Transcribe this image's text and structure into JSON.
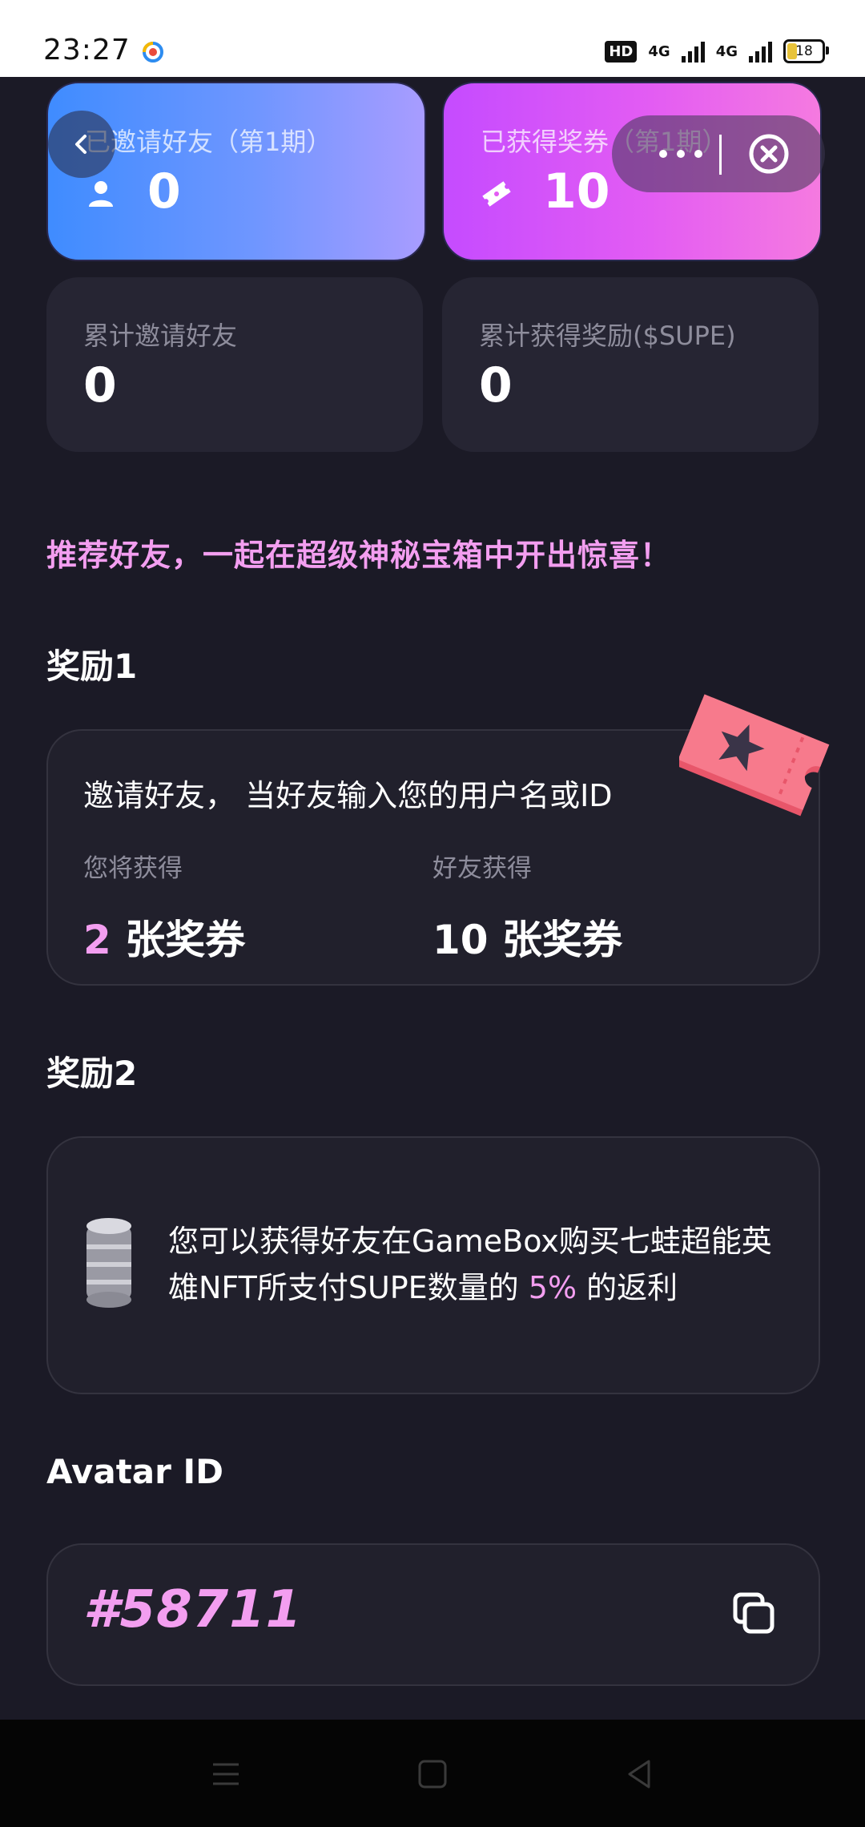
{
  "status_bar": {
    "time": "23:27",
    "hd_badge": "HD",
    "net_1": "4G",
    "net_2": "4G",
    "battery": "18"
  },
  "stats": {
    "invited_current": {
      "label": "已邀请好友（第1期）",
      "value": "0",
      "icon": "user-icon"
    },
    "tickets_current": {
      "label": "已获得奖券（第1期）",
      "value": "10",
      "icon": "ticket-icon"
    },
    "invited_total": {
      "label": "累计邀请好友",
      "value": "0"
    },
    "reward_total": {
      "label": "累计获得奖励($SUPE)",
      "value": "0"
    }
  },
  "headline": "推荐好友，一起在超级神秘宝箱中开出惊喜！",
  "reward1": {
    "title": "奖励1",
    "description": "邀请好友， 当好友输入您的用户名或ID",
    "you_get_label": "您将获得",
    "you_get_number": "2",
    "you_get_unit": " 张奖券",
    "friend_get_label": "好友获得",
    "friend_get_amount": "10 张奖券"
  },
  "reward2": {
    "title": "奖励2",
    "text_before": "您可以获得好友在GameBox购买七蛙超能英雄NFT所支付SUPE数量的 ",
    "percent": "5%",
    "text_after": " 的返利"
  },
  "avatar": {
    "title": "Avatar ID",
    "id": "#58711"
  },
  "colors": {
    "background": "#1b1a26",
    "accent_pink": "#f39ef0",
    "card_dark": "#262533"
  }
}
